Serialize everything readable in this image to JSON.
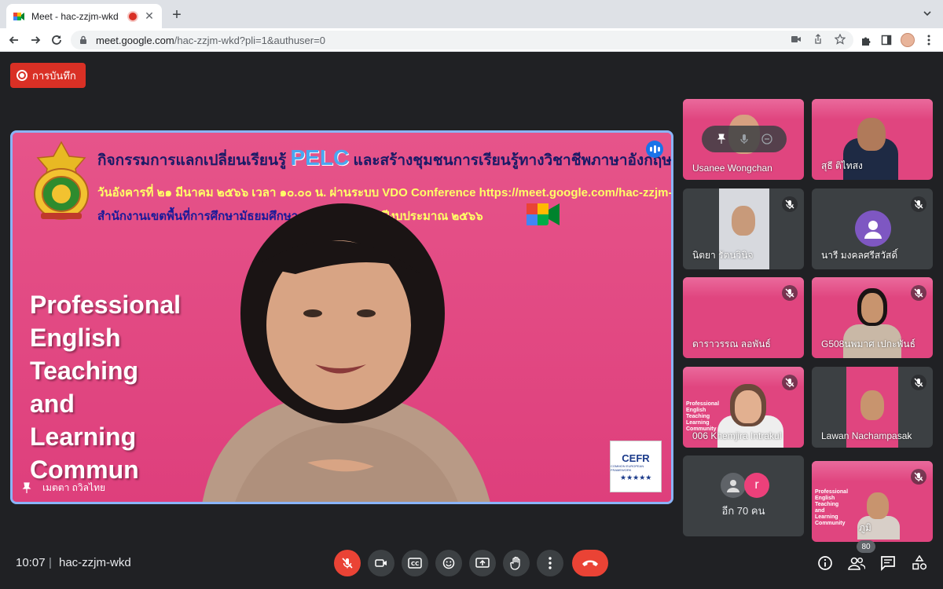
{
  "browser": {
    "tab_title": "Meet - hac-zzjm-wkd",
    "url_host": "meet.google.com",
    "url_path": "/hac-zzjm-wkd?pli=1&authuser=0"
  },
  "recording": {
    "label": "การบันทึก"
  },
  "slide": {
    "title_before": "กิจกรรมการแลกเปลี่ยนเรียนรู้ ",
    "title_pelc": "PELC",
    "title_after": " และสร้างชุมชนการเรียนรู้ทางวิชาชีพภาษาอังกฤษ",
    "line2": "วันอังคารที่ ๒๑ มีนาคม ๒๕๖๖ เวลา ๑๐.๐๐ น. ผ่านระบบ VDO Conference https://meet.google.com/hac-zzjm-wkd",
    "line3": "สำนักงานเขตพื้นที่การศึกษามัธยมศึกษา",
    "line3b": "ปีงบประมาณ ๒๕๖๖",
    "big_lines": [
      "Professional",
      "English",
      "Teaching",
      "and",
      "Learning",
      "Commun"
    ],
    "cefr": "CEFR",
    "cefr_sub": "COMMON EUROPEAN FRAMEWORK"
  },
  "main_participant": {
    "name": "เมตตา ถวิลไทย"
  },
  "participants": [
    {
      "name": "Usanee Wongchan"
    },
    {
      "name": "สุธี ติไทสง"
    },
    {
      "name": "นิตยา รัตนวินิจ"
    },
    {
      "name": "นารี มงคลศรีสวัสดิ์"
    },
    {
      "name": "ดาราวรรณ ลอพันธ์"
    },
    {
      "name": "G508นพมาศ เปกะพันธ์"
    },
    {
      "name": "006 Khemjira Intrakul"
    },
    {
      "name": "Lawan Nachampasak"
    },
    {
      "name": "อีก 70 คน",
      "initial": "r"
    },
    {
      "name": "ภูมิ"
    }
  ],
  "bottom": {
    "time": "10:07",
    "separator": "|",
    "meeting_code": "hac-zzjm-wkd",
    "people_count": "80"
  },
  "colors": {
    "slide_pink": "#e0457f",
    "record_red": "#d93025",
    "speaker_border": "#8ab4f8",
    "avatar_purple": "#7e57c2"
  }
}
